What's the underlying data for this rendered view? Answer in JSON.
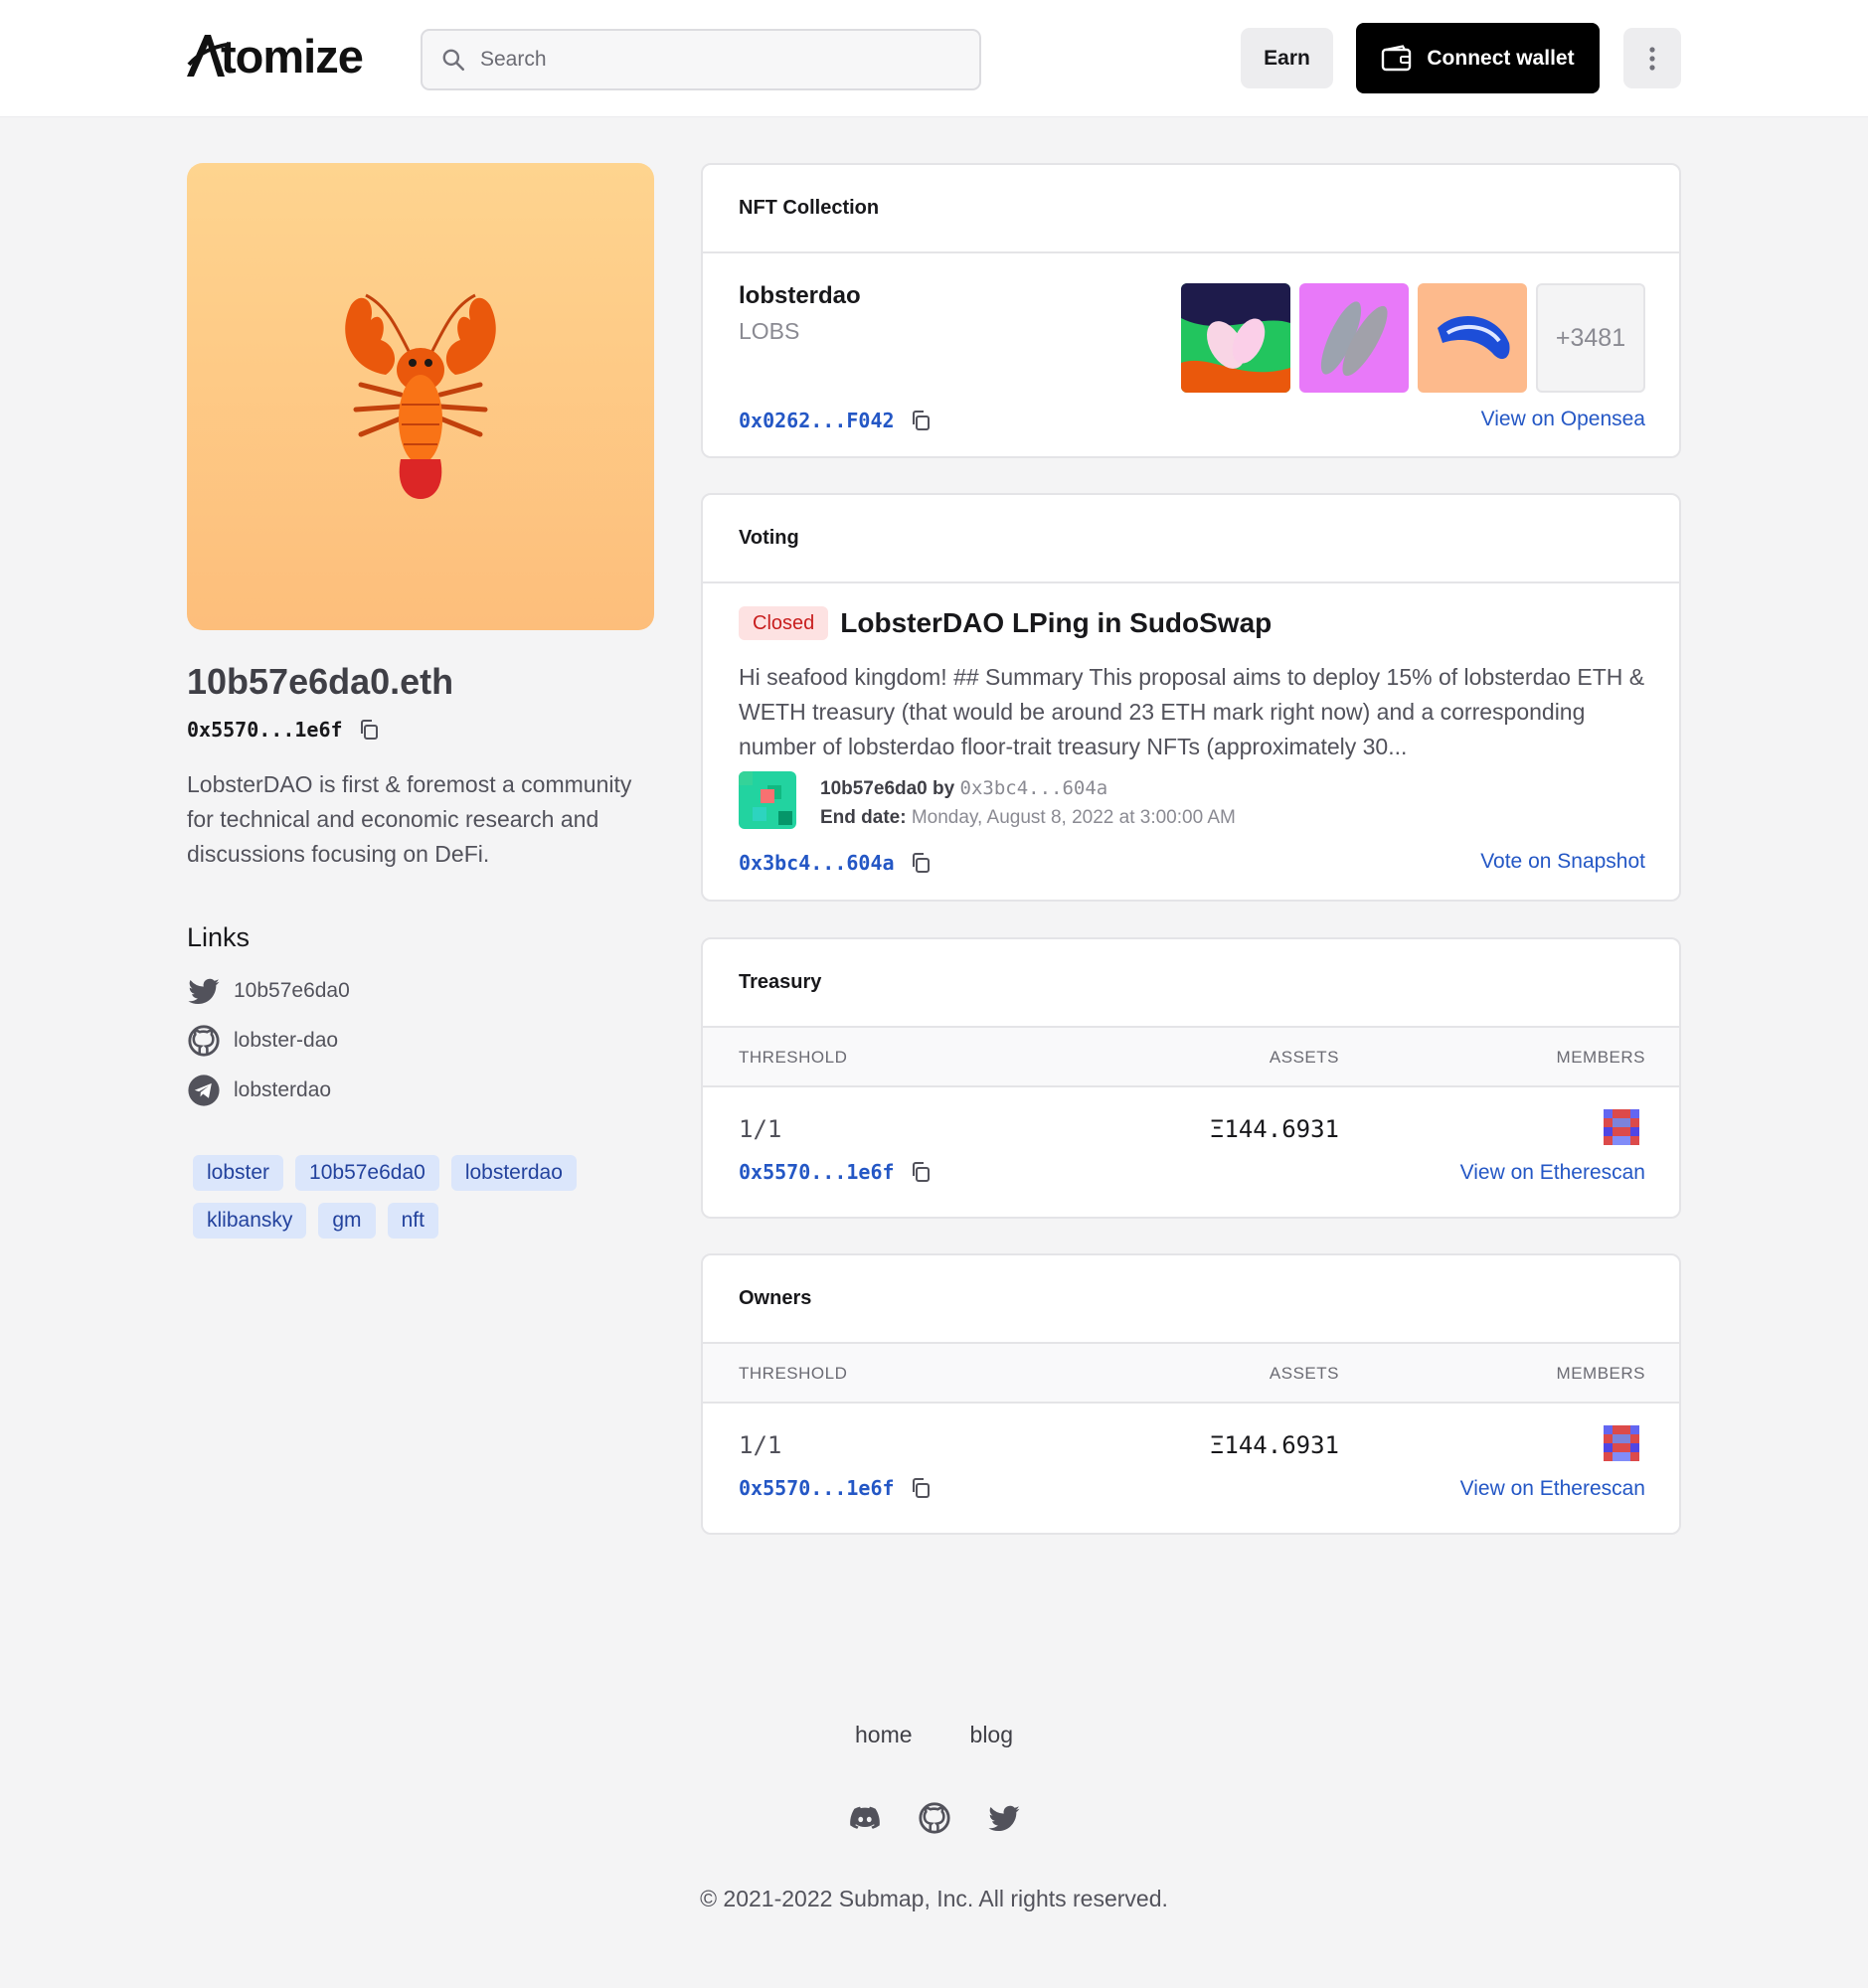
{
  "header": {
    "logo_text": "tomize",
    "search_placeholder": "Search",
    "earn_label": "Earn",
    "connect_label": "Connect wallet"
  },
  "profile": {
    "ens": "10b57e6da0.eth",
    "address": "0x5570...1e6f",
    "description": "LobsterDAO is first & foremost a community for technical and economic research and discussions focusing on DeFi.",
    "links_title": "Links",
    "links": [
      {
        "icon": "twitter-icon",
        "label": "10b57e6da0"
      },
      {
        "icon": "github-icon",
        "label": "lobster-dao"
      },
      {
        "icon": "telegram-icon",
        "label": "lobsterdao"
      }
    ],
    "tags": [
      "lobster",
      "10b57e6da0",
      "lobsterdao",
      "klibansky",
      "gm",
      "nft"
    ]
  },
  "nft": {
    "heading": "NFT Collection",
    "name": "lobsterdao",
    "symbol": "LOBS",
    "address": "0x0262...F042",
    "more_count": "+3481",
    "view_label": "View on Opensea"
  },
  "voting": {
    "heading": "Voting",
    "status": "Closed",
    "title": "LobsterDAO LPing in SudoSwap",
    "body": "Hi seafood kingdom! ## Summary This proposal aims to deploy 15% of lobsterdao ETH & WETH treasury (that would be around 23 ETH mark right now) and a corresponding number of lobsterdao floor-trait treasury NFTs (approximately 30...",
    "author": "10b57e6da0",
    "by_label": "by",
    "author_address": "0x3bc4...604a",
    "end_label": "End date:",
    "end_date": "Monday, August 8, 2022 at 3:00:00 AM",
    "address": "0x3bc4...604a",
    "vote_label": "Vote on Snapshot"
  },
  "treasury": {
    "heading": "Treasury",
    "col_threshold": "THRESHOLD",
    "col_assets": "ASSETS",
    "col_members": "MEMBERS",
    "threshold": "1/1",
    "assets": "Ξ144.6931",
    "address": "0x5570...1e6f",
    "view_label": "View on Etherescan"
  },
  "owners": {
    "heading": "Owners",
    "col_threshold": "THRESHOLD",
    "col_assets": "ASSETS",
    "col_members": "MEMBERS",
    "threshold": "1/1",
    "assets": "Ξ144.6931",
    "address": "0x5570...1e6f",
    "view_label": "View on Etherescan"
  },
  "footer": {
    "links": [
      "home",
      "blog"
    ],
    "icons": [
      "discord-icon",
      "github-icon",
      "twitter-icon"
    ],
    "copyright": "© 2021-2022 Submap, Inc. All rights reserved."
  }
}
